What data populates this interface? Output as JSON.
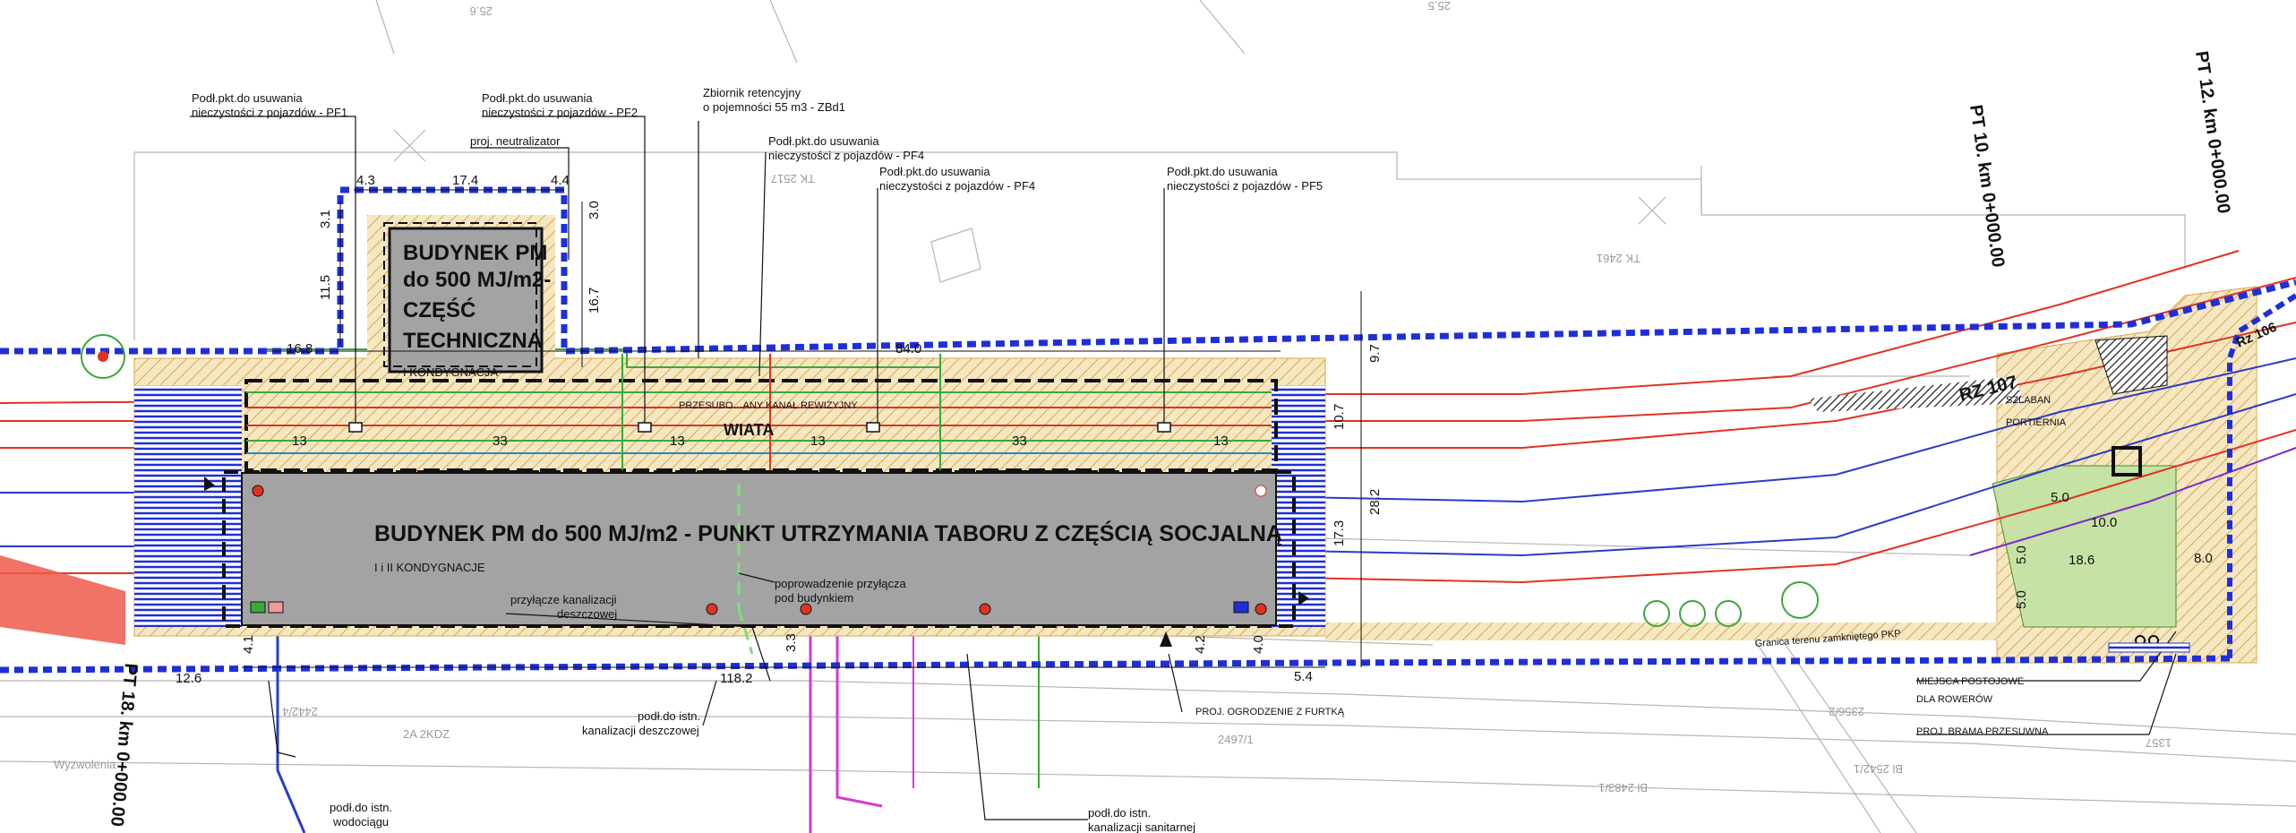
{
  "colors": {
    "fence": "#1f2fd8",
    "hatch": "#e8b84a",
    "building": "#a3a3a3",
    "red_line": "#e23221",
    "blue_line": "#2a3cc8",
    "green_line": "#3aa83a",
    "magenta_line": "#d23cd2",
    "orange_text": "#e07a1c"
  },
  "icons": [
    "north-arrow-icon",
    "hydrant-icon",
    "tree-icon",
    "bicycle-icon",
    "gate-icon"
  ],
  "callouts": {
    "pf1": [
      "Podł.pkt.do usuwania",
      "nieczystości z pojazdów - PF1"
    ],
    "pf2": [
      "Podł.pkt.do usuwania",
      "nieczystości z pojazdów - PF2"
    ],
    "neutralizer": "proj. neutralizator",
    "retention": [
      "Zbiornik retencyjny",
      "o pojemności 55 m3 - ZBd1"
    ],
    "pf4a": [
      "Podł.pkt.do usuwania",
      "nieczystości z pojazdów - PF4"
    ],
    "pf4b": [
      "Podł.pkt.do usuwania",
      "nieczystości z pojazdów - PF4"
    ],
    "pf5": [
      "Podł.pkt.do usuwania",
      "nieczystości z pojazdów - PF5"
    ],
    "rain_conn": [
      "przyłącze kanalizacji",
      "deszczowej"
    ],
    "under_building": [
      "poprowadzenie przyłącza",
      "pod budynkiem"
    ],
    "rain_existing": [
      "podł.do istn.",
      "kanalizacji deszczowej"
    ],
    "water_existing": [
      "podł.do istn.",
      "wodociągu"
    ],
    "sanitary_existing": [
      "podł.do istn.",
      "kanalizacji sanitarnej"
    ],
    "fence_gate": "PROJ. OGRODZENIE Z FURTKĄ",
    "bike_parking": [
      "MIEJSCA POSTOJOWE",
      "DLA ROWERÓW"
    ],
    "sliding_gate": "PROJ. BRAMA PRZESUWNA",
    "barrier": "SZLABAN",
    "gatehouse": "PORTIERNIA",
    "plot_boundary": "Granica terenu zamkniętego PKP"
  },
  "buildings": {
    "technical": [
      "BUDYNEK PM",
      "do 500 MJ/m2-",
      "CZĘŚĆ",
      "TECHNICZNA",
      "I KONDYGNACJA"
    ],
    "main_title": "BUDYNEK PM do 500 MJ/m2 - PUNKT UTRZYMANIA TABORU Z CZĘŚCIĄ SOCJALNĄ",
    "main_sub": "I i II KONDYGNACJE",
    "shelter": "WIATA",
    "inspection_canal": "PRZESUBO…ANY KANAŁ REWIZYJNY"
  },
  "dimensions": {
    "d43": "4.3",
    "d174": "17.4",
    "d44": "4.4",
    "d31": "3.1",
    "d30": "3.0",
    "d115": "11.5",
    "d167": "16.7",
    "d168": "16.8",
    "d840": "84.0",
    "d97": "9.7",
    "d107": "10.7",
    "d282": "28.2",
    "d173": "17.3",
    "d13a": "13",
    "d33a": "33",
    "d13b": "13",
    "d13c": "13",
    "d33b": "33",
    "d13d": "13",
    "d41": "4.1",
    "d40": "4.0",
    "d42": "4.2",
    "d33": "3.3",
    "d126": "12.6",
    "d1182": "118.2",
    "d54": "5.4",
    "d50a": "5.0",
    "d100": "10.0",
    "d50b": "5.0",
    "d186": "18.6",
    "d80": "8.0",
    "d50c": "5.0"
  },
  "kilometres": {
    "pt10": "PT 10. km 0+000.00",
    "pt12": "PT 12. km 0+000.00",
    "pt18": "PT 18. km 0+000.00",
    "rz107": "RZ 107",
    "rz106": "Rz 106"
  },
  "map_text": {
    "elev256": "25.6",
    "elev255": "25.5",
    "tk2517": "TK 2517",
    "tk2461": "TK 2461",
    "wyzwolenia": "Wyzwolenia",
    "plot24424": "2442/4",
    "kdz": "2A 2KDZ",
    "plot24971": "2497/1",
    "plot23562": "2356/2",
    "plot24831": "Bl 2483/1",
    "plot25421": "Bl 2542/1",
    "plot1357": "1357"
  }
}
